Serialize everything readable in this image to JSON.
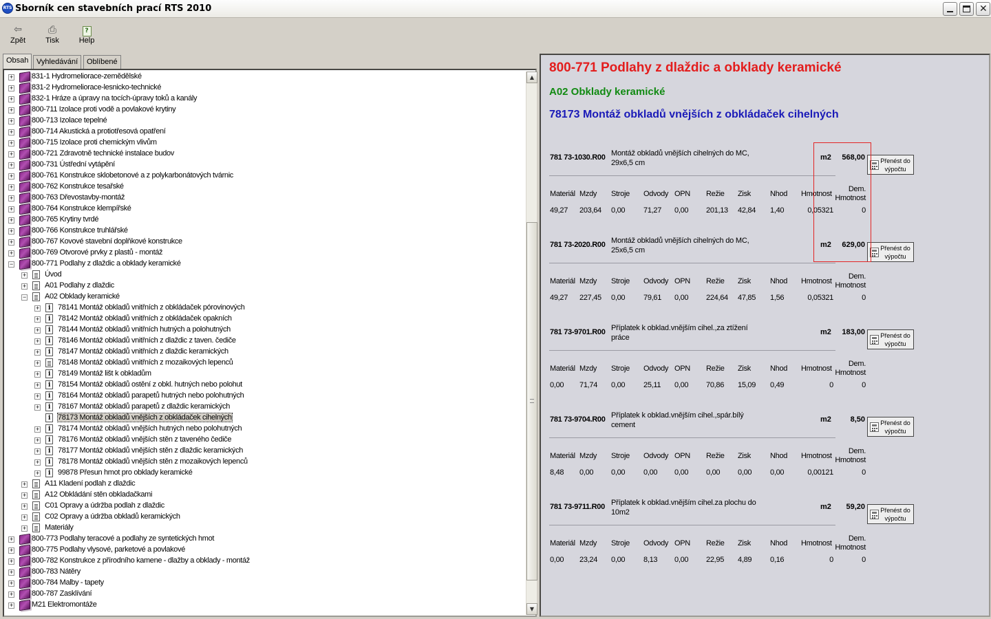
{
  "window": {
    "title": "Sborník cen stavebních prací RTS 2010",
    "icon_label": "RTS"
  },
  "toolbar": {
    "back": "Zpět",
    "print": "Tisk",
    "help": "Help"
  },
  "tabs": [
    "Obsah",
    "Vyhledávání",
    "Oblíbené položky"
  ],
  "tree": [
    {
      "label": "831-1 Hydromeliorace-zemědělské",
      "level": 0,
      "icon": "book-icon",
      "expander": "+"
    },
    {
      "label": "831-2 Hydromeliorace-lesnicko-technické",
      "level": 0,
      "icon": "book-icon",
      "expander": "+"
    },
    {
      "label": "832-1 Hráze a úpravy na tocích-úpravy toků a kanály",
      "level": 0,
      "icon": "book-icon",
      "expander": "+"
    },
    {
      "label": "800-711 Izolace proti vodě a povlakové krytiny",
      "level": 0,
      "icon": "book-icon",
      "expander": "+"
    },
    {
      "label": "800-713 Izolace tepelné",
      "level": 0,
      "icon": "book-icon",
      "expander": "+"
    },
    {
      "label": "800-714 Akustická a protiotřesová opatření",
      "level": 0,
      "icon": "book-icon",
      "expander": "+"
    },
    {
      "label": "800-715 Izolace proti chemickým vlivům",
      "level": 0,
      "icon": "book-icon",
      "expander": "+"
    },
    {
      "label": "800-721 Zdravotně technické instalace budov",
      "level": 0,
      "icon": "book-icon",
      "expander": "+"
    },
    {
      "label": "800-731 Ústřední vytápění",
      "level": 0,
      "icon": "book-icon",
      "expander": "+"
    },
    {
      "label": "800-761 Konstrukce sklobetonové a z polykarbonátových tvárnic",
      "level": 0,
      "icon": "book-icon",
      "expander": "+"
    },
    {
      "label": "800-762 Konstrukce tesařské",
      "level": 0,
      "icon": "book-icon",
      "expander": "+"
    },
    {
      "label": "800-763 Dřevostavby-montáž",
      "level": 0,
      "icon": "book-icon",
      "expander": "+"
    },
    {
      "label": "800-764 Konstrukce klempířské",
      "level": 0,
      "icon": "book-icon",
      "expander": "+"
    },
    {
      "label": "800-765 Krytiny tvrdé",
      "level": 0,
      "icon": "book-icon",
      "expander": "+"
    },
    {
      "label": "800-766 Konstrukce truhlářské",
      "level": 0,
      "icon": "book-icon",
      "expander": "+"
    },
    {
      "label": "800-767 Kovové stavební doplňkové konstrukce",
      "level": 0,
      "icon": "book-icon",
      "expander": "+"
    },
    {
      "label": "800-769 Otvorové prvky z plastů - montáž",
      "level": 0,
      "icon": "book-icon",
      "expander": "+"
    },
    {
      "label": "800-771 Podlahy z dlaždic a obklady keramické",
      "level": 0,
      "icon": "book-icon",
      "expander": "−"
    },
    {
      "label": "Úvod",
      "level": 1,
      "icon": "doc-icon",
      "expander": "+"
    },
    {
      "label": "A01 Podlahy z dlaždic",
      "level": 1,
      "icon": "doc-icon",
      "expander": "+"
    },
    {
      "label": "A02 Obklady keramické",
      "level": 1,
      "icon": "doc-icon",
      "expander": "−"
    },
    {
      "label": "78141 Montáž obkladů vnitřních z obkládaček pórovinových",
      "level": 2,
      "icon": "info-icon",
      "expander": "+"
    },
    {
      "label": "78142 Montáž obkladů vnitřních z obkládaček opakních",
      "level": 2,
      "icon": "info-icon",
      "expander": "+"
    },
    {
      "label": "78144 Montáž obkladů vnitřních hutných a polohutných",
      "level": 2,
      "icon": "info-icon",
      "expander": "+"
    },
    {
      "label": "78146 Montáž obkladů vnitřních z dlaždic z taven. čediče",
      "level": 2,
      "icon": "info-icon",
      "expander": "+"
    },
    {
      "label": "78147 Montáž obkladů vnitřních z dlaždic keramických",
      "level": 2,
      "icon": "info-icon",
      "expander": "+"
    },
    {
      "label": "78148 Montáž obkladů vnitřních z mozaikových lepenců",
      "level": 2,
      "icon": "doc-icon",
      "expander": "+"
    },
    {
      "label": "78149 Montáž lišt k obkladům",
      "level": 2,
      "icon": "info-icon",
      "expander": "+"
    },
    {
      "label": "78154 Montáž obkladů ostění z obkl. hutných nebo polohut",
      "level": 2,
      "icon": "info-icon",
      "expander": "+"
    },
    {
      "label": "78164 Montáž obkladů parapetů hutných nebo polohutných",
      "level": 2,
      "icon": "info-icon",
      "expander": "+"
    },
    {
      "label": "78167 Montáž obkladů parapetů z dlaždic keramických",
      "level": 2,
      "icon": "info-icon",
      "expander": "+"
    },
    {
      "label": "78173 Montáž obkladů vnějších z obkládaček cihelných",
      "level": 2,
      "icon": "info-icon",
      "expander": "",
      "selected": true
    },
    {
      "label": "78174 Montáž obkladů vnějších hutných nebo polohutných",
      "level": 2,
      "icon": "info-icon",
      "expander": "+"
    },
    {
      "label": "78176 Montáž obkladů vnějších stěn z taveného čediče",
      "level": 2,
      "icon": "info-icon",
      "expander": "+"
    },
    {
      "label": "78177 Montáž obkladů vnějších stěn z dlaždic keramických",
      "level": 2,
      "icon": "info-icon",
      "expander": "+"
    },
    {
      "label": "78178 Montáž obkladů vnějších stěn z mozaikových lepenců",
      "level": 2,
      "icon": "info-icon",
      "expander": "+"
    },
    {
      "label": "99878 Přesun hmot pro obklady keramické",
      "level": 2,
      "icon": "info-icon",
      "expander": "+"
    },
    {
      "label": "A11 Kladení podlah z dlaždic",
      "level": 1,
      "icon": "doc-icon",
      "expander": "+"
    },
    {
      "label": "A12 Obkládání stěn obkladačkami",
      "level": 1,
      "icon": "doc-icon",
      "expander": "+"
    },
    {
      "label": "C01 Opravy a údržba podlah z dlaždic",
      "level": 1,
      "icon": "doc-icon",
      "expander": "+"
    },
    {
      "label": "C02 Opravy a údržba obkladů keramických",
      "level": 1,
      "icon": "doc-icon",
      "expander": "+"
    },
    {
      "label": "Materiály",
      "level": 1,
      "icon": "doc-icon",
      "expander": "+"
    },
    {
      "label": "800-773 Podlahy teracové a podlahy ze syntetických hmot",
      "level": 0,
      "icon": "book-icon",
      "expander": "+"
    },
    {
      "label": "800-775 Podlahy vlysové, parketové a povlakové",
      "level": 0,
      "icon": "book-icon",
      "expander": "+"
    },
    {
      "label": "800-782 Konstrukce z přírodního kamene - dlažby a obklady - montáž",
      "level": 0,
      "icon": "book-icon",
      "expander": "+"
    },
    {
      "label": "800-783 Nátěry",
      "level": 0,
      "icon": "book-icon",
      "expander": "+"
    },
    {
      "label": "800-784 Malby - tapety",
      "level": 0,
      "icon": "book-icon",
      "expander": "+"
    },
    {
      "label": "800-787 Zasklívání",
      "level": 0,
      "icon": "book-icon",
      "expander": "+"
    },
    {
      "label": "M21 Elektromontáže",
      "level": 0,
      "icon": "book-icon",
      "expander": "+"
    }
  ],
  "content": {
    "title": "800-771 Podlahy z dlaždic a obklady keramické",
    "subtitle": "A02 Obklady keramické",
    "section": "78173 Montáž obkladů vnějších z obkládaček cihelných",
    "transfer_label_1": "Přenést do",
    "transfer_label_2": "výpočtu",
    "headers": [
      "Materiál",
      "Mzdy",
      "Stroje",
      "Odvody",
      "OPN",
      "Režie",
      "Zisk",
      "Nhod",
      "Hmotnost"
    ],
    "dem_header_1": "Dem.",
    "dem_header_2": "Hmotnost",
    "items": [
      {
        "code": "781 73-1030.R00",
        "desc": "Montáž obkladů vnějších cihelných do MC, 29x6,5 cm",
        "unit": "m2",
        "price": "568,00",
        "values": [
          "49,27",
          "203,64",
          "0,00",
          "71,27",
          "0,00",
          "201,13",
          "42,84",
          "1,40",
          "0,05321",
          "0"
        ]
      },
      {
        "code": "781 73-2020.R00",
        "desc": "Montáž obkladů vnějších cihelných do MC, 25x6,5 cm",
        "unit": "m2",
        "price": "629,00",
        "values": [
          "49,27",
          "227,45",
          "0,00",
          "79,61",
          "0,00",
          "224,64",
          "47,85",
          "1,56",
          "0,05321",
          "0"
        ]
      },
      {
        "code": "781 73-9701.R00",
        "desc": "Příplatek k obklad.vnějším cihel.,za ztížení práce",
        "unit": "m2",
        "price": "183,00",
        "values": [
          "0,00",
          "71,74",
          "0,00",
          "25,11",
          "0,00",
          "70,86",
          "15,09",
          "0,49",
          "0",
          "0"
        ]
      },
      {
        "code": "781 73-9704.R00",
        "desc": "Příplatek k obklad.vnějším cihel.,spár.bílý cement",
        "unit": "m2",
        "price": "8,50",
        "values": [
          "8,48",
          "0,00",
          "0,00",
          "0,00",
          "0,00",
          "0,00",
          "0,00",
          "0,00",
          "0,00121",
          "0"
        ]
      },
      {
        "code": "781 73-9711.R00",
        "desc": "Příplatek k obklad.vnějším cihel.za plochu do 10m2",
        "unit": "m2",
        "price": "59,20",
        "values": [
          "0,00",
          "23,24",
          "0,00",
          "8,13",
          "0,00",
          "22,95",
          "4,89",
          "0,16",
          "0",
          "0"
        ]
      }
    ]
  },
  "colors": {
    "title": "#e31d1d",
    "subtitle": "#118a12",
    "section": "#1a1ab8",
    "highlight": "#e32424"
  }
}
